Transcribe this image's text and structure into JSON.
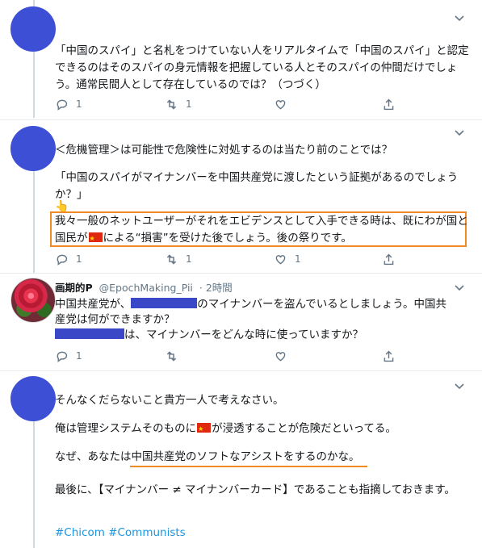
{
  "tweets": [
    {
      "text": "「中国のスパイ」と名札をつけていない人をリアルタイムで「中国のスパイ」と認定できるのはそのスパイの身元情報を把握している人とそのスパイの仲間だけでしょう。通常民間人として存在しているのでは？（つづく）",
      "reply_count": "1",
      "retweet_count": "1",
      "like_count": ""
    },
    {
      "line1": "＜危機管理＞は可能性で危険性に対処するのは当たり前のことでは？",
      "line2": "「中国のスパイがマイナンバーを中国共産党に渡したという証拠があるのでしょうか？」",
      "hand_emoji": "👆",
      "boxed_a": "我々一般のネットユーザーがそれをエビデンスとして入手できる時は、既にわが国と国民が",
      "boxed_b": "による“損害”を受けた後でしょう。後の祭りです。",
      "reply_count": "1",
      "retweet_count": "1",
      "like_count": "1"
    },
    {
      "name": "画期的P",
      "handle": "@EpochMaking_Pii",
      "time": "· 2時間",
      "line1a": "中国共産党が、",
      "line1b": "のマイナンバーを盗んでいるとしましょう。中国共",
      "line2": "産党は何ができますか？",
      "line3b": "は、マイナンバーをどんな時に使っていますか？",
      "reply_count": "1",
      "retweet_count": "",
      "like_count": ""
    },
    {
      "p1": "そんなくだらないこと貴方一人で考えなさい。",
      "p2a": "俺は管理システムそのものに",
      "p2b": "が浸透することが危険だといってる。",
      "p3a": "なぜ、あなたは",
      "p3b": "中国共産党のソフトなアシストをするのかな。",
      "p4": "最後に、【マイナンバー ≠ マイナンバーカード】であることも指摘しておきます。",
      "hashtags": "#Chicom #Communists"
    }
  ],
  "icons": [
    "chevron-down-icon",
    "reply-icon",
    "retweet-icon",
    "like-icon",
    "share-icon",
    "china-flag-icon"
  ],
  "colors": {
    "accent": "#1b95e0",
    "highlight": "#f08a24",
    "avatar": "#3d4fd4"
  }
}
